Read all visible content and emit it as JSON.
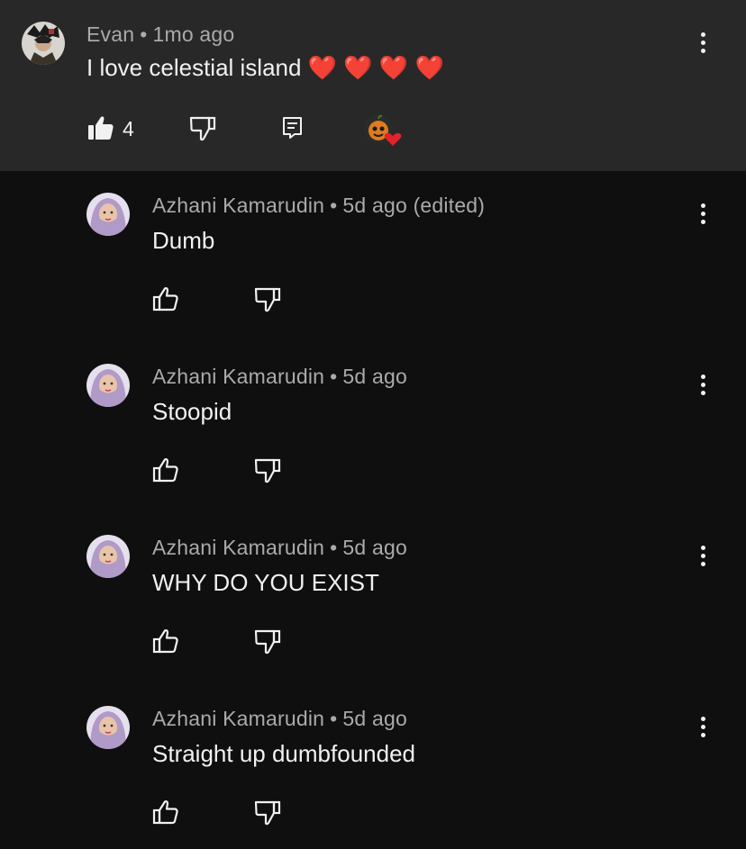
{
  "main_comment": {
    "author": "Evan",
    "separator": "•",
    "time": "1mo ago",
    "text": "I love celestial island",
    "emojis": [
      "❤️",
      "❤️",
      "❤️",
      "❤️"
    ],
    "like_count": "4",
    "icons": {
      "like": "thumbs-up-filled-icon",
      "dislike": "thumbs-down-icon",
      "reply": "reply-comment-icon",
      "creator_heart": "creator-heart-badge",
      "menu": "kebab-menu-icon"
    }
  },
  "replies": [
    {
      "author": "Azhani Kamarudin",
      "separator": "•",
      "time": "5d ago",
      "edited": "(edited)",
      "text": "Dumb"
    },
    {
      "author": "Azhani Kamarudin",
      "separator": "•",
      "time": "5d ago",
      "edited": "",
      "text": "Stoopid"
    },
    {
      "author": "Azhani Kamarudin",
      "separator": "•",
      "time": "5d ago",
      "edited": "",
      "text": "WHY DO YOU EXIST"
    },
    {
      "author": "Azhani Kamarudin",
      "separator": "•",
      "time": "5d ago",
      "edited": "",
      "text": "Straight up dumbfounded"
    }
  ],
  "colors": {
    "background": "#0f0f0f",
    "highlight_background": "#282828",
    "text": "#f1f1f1",
    "secondary_text": "#aaaaaa",
    "heart": "#e2232b"
  }
}
